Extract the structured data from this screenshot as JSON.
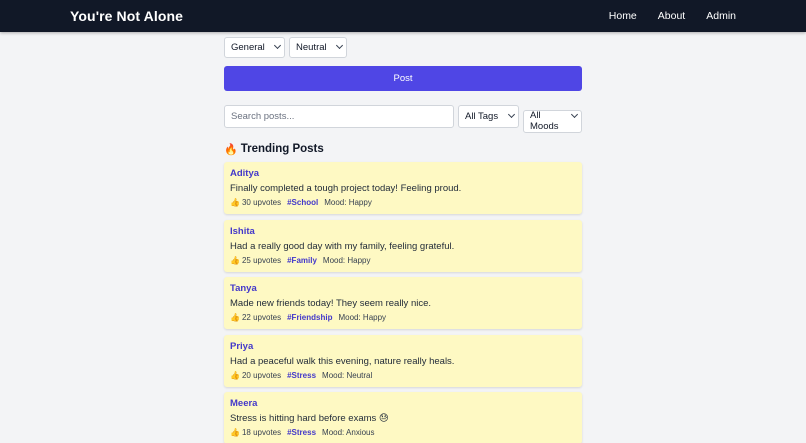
{
  "nav": {
    "brand": "You're Not Alone",
    "links": [
      "Home",
      "About",
      "Admin"
    ]
  },
  "composer": {
    "category_selected": "General",
    "mood_selected": "Neutral",
    "post_label": "Post"
  },
  "filters": {
    "search_placeholder": "Search posts...",
    "tag_selected": "All Tags",
    "mood_selected": "All Moods"
  },
  "trending": {
    "icon": "flame-icon",
    "title": "Trending Posts",
    "posts": [
      {
        "author": "Aditya",
        "text": "Finally completed a tough project today! Feeling proud.",
        "upvotes": "30 upvotes",
        "tag": "#School",
        "mood": "Mood: Happy"
      },
      {
        "author": "Ishita",
        "text": "Had a really good day with my family, feeling grateful.",
        "upvotes": "25 upvotes",
        "tag": "#Family",
        "mood": "Mood: Happy"
      },
      {
        "author": "Tanya",
        "text": "Made new friends today! They seem really nice.",
        "upvotes": "22 upvotes",
        "tag": "#Friendship",
        "mood": "Mood: Happy"
      },
      {
        "author": "Priya",
        "text": "Had a peaceful walk this evening, nature really heals.",
        "upvotes": "20 upvotes",
        "tag": "#Stress",
        "mood": "Mood: Neutral"
      },
      {
        "author": "Meera",
        "text": "Stress is hitting hard before exams 😓",
        "upvotes": "18 upvotes",
        "tag": "#Stress",
        "mood": "Mood: Anxious"
      }
    ]
  },
  "colors": {
    "navbar": "#111827",
    "accent": "#4f46e5",
    "post_bg": "#fef9c3",
    "author": "#4338ca"
  }
}
